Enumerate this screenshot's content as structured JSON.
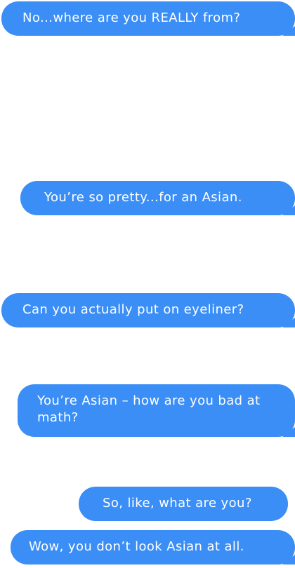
{
  "bubble_color": "#3a8ef6",
  "messages": [
    {
      "text": "No...where are you REALLY from?",
      "tail": true
    },
    {
      "text": "You’re so pretty...for an Asian.",
      "tail": true
    },
    {
      "text": "Can you actually put on eyeliner?",
      "tail": true
    },
    {
      "text": "You’re Asian – how are you bad at math?",
      "tail": true
    },
    {
      "text": "So, like, what are you?",
      "tail": false
    },
    {
      "text": "Wow, you don’t look Asian at all.",
      "tail": true
    }
  ]
}
